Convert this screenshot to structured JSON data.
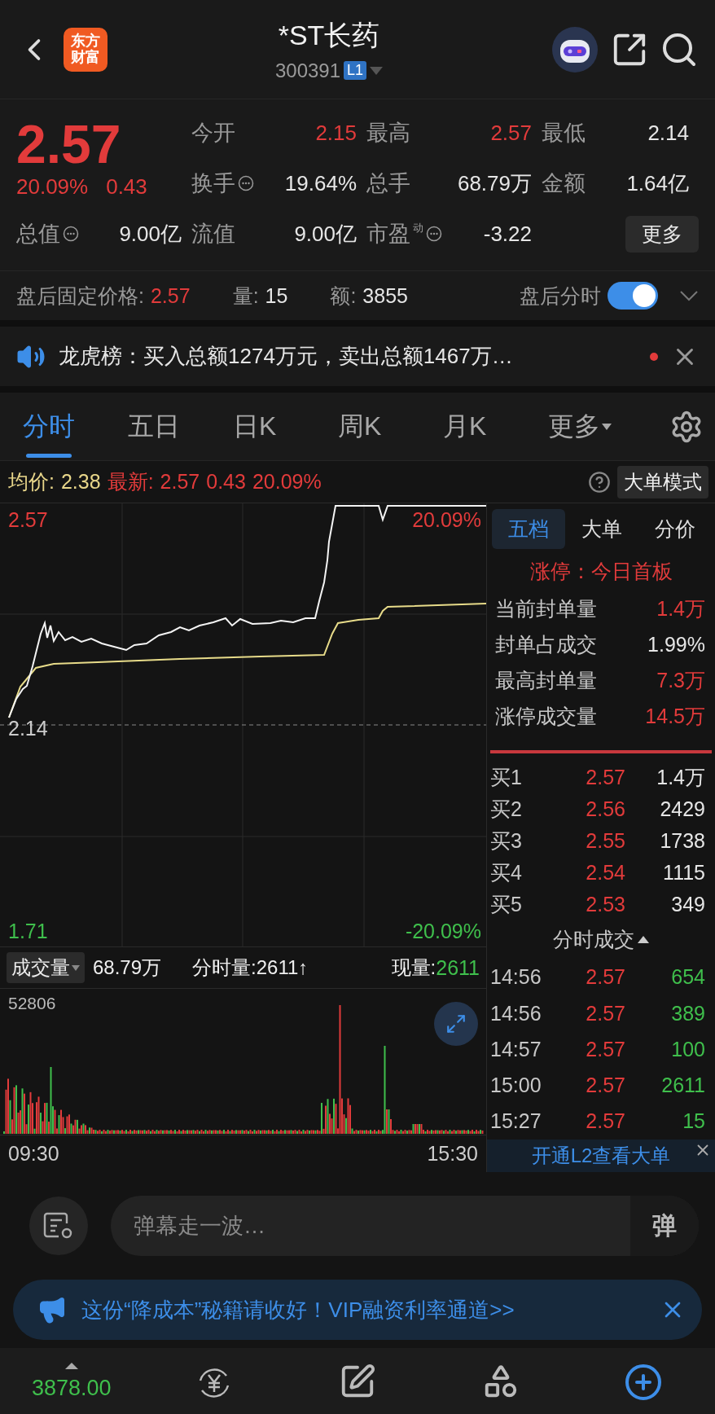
{
  "header": {
    "logo": "东方财富",
    "title": "*ST长药",
    "code": "300391",
    "level_badge": "L1"
  },
  "quote": {
    "price": "2.57",
    "change_pct": "20.09%",
    "change": "0.43",
    "more_button": "更多",
    "stats": [
      {
        "label": "今开",
        "value": "2.15",
        "color": "#e23b3b"
      },
      {
        "label": "最高",
        "value": "2.57",
        "color": "#e23b3b"
      },
      {
        "label": "最低",
        "value": "2.14",
        "color": "#e6e6e6"
      },
      {
        "label": "换手",
        "info": true,
        "value": "19.64%",
        "color": "#e6e6e6"
      },
      {
        "label": "总手",
        "value": "68.79万",
        "color": "#e6e6e6"
      },
      {
        "label": "金额",
        "value": "1.64亿",
        "color": "#e6e6e6"
      },
      {
        "label": "总值",
        "info": true,
        "value": "9.00亿",
        "color": "#e6e6e6"
      },
      {
        "label": "流值",
        "value": "9.00亿",
        "color": "#e6e6e6"
      },
      {
        "label": "市盈",
        "sup": "动",
        "info": true,
        "value": "-3.22",
        "color": "#e6e6e6"
      }
    ]
  },
  "after_hours": {
    "label": "盘后固定价格:",
    "price": "2.57",
    "vol_label": "量:",
    "vol": "15",
    "amt_label": "额:",
    "amt": "3855",
    "toggle_label": "盘后分时",
    "on": true
  },
  "notice": {
    "text": "龙虎榜：买入总额1274万元，卖出总额1467万…",
    "dot": true
  },
  "tabs": [
    {
      "label": "分时",
      "selected": true,
      "dropdown": false
    },
    {
      "label": "五日",
      "selected": false,
      "dropdown": false
    },
    {
      "label": "日K",
      "selected": false,
      "dropdown": false
    },
    {
      "label": "周K",
      "selected": false,
      "dropdown": false
    },
    {
      "label": "月K",
      "selected": false,
      "dropdown": false
    },
    {
      "label": "更多",
      "selected": false,
      "dropdown": true
    }
  ],
  "chart_header": {
    "avg_label": "均价:",
    "avg": "2.38",
    "last_label": "最新:",
    "last": "2.57",
    "change": "0.43",
    "pct": "20.09%",
    "mode_button": "大单模式"
  },
  "price_chart": {
    "high": "2.57",
    "high_pct": "20.09%",
    "base": "2.14",
    "low": "1.71",
    "low_pct": "-20.09%"
  },
  "volume": {
    "menu": "成交量",
    "total": "68.79万",
    "tick": "分时量:2611↑",
    "now_label": "现量:",
    "now": "2611",
    "max": "52806",
    "start": "09:30",
    "end": "15:30"
  },
  "panel": {
    "tabs": [
      {
        "label": "五档",
        "selected": true
      },
      {
        "label": "大单",
        "selected": false
      },
      {
        "label": "分价",
        "selected": false
      }
    ],
    "limit_title": "涨停：今日首板",
    "limit_stats": [
      {
        "label": "当前封单量",
        "value": "1.4万",
        "color": "#e23b3b"
      },
      {
        "label": "封单占成交",
        "value": "1.99%",
        "color": "#e6e6e6"
      },
      {
        "label": "最高封单量",
        "value": "7.3万",
        "color": "#e23b3b"
      },
      {
        "label": "涨停成交量",
        "value": "14.5万",
        "color": "#e23b3b"
      }
    ],
    "bids": [
      {
        "label": "买1",
        "price": "2.57",
        "volume": "1.4万"
      },
      {
        "label": "买2",
        "price": "2.56",
        "volume": "2429"
      },
      {
        "label": "买3",
        "price": "2.55",
        "volume": "1738"
      },
      {
        "label": "买4",
        "price": "2.54",
        "volume": "1115"
      },
      {
        "label": "买5",
        "price": "2.53",
        "volume": "349"
      }
    ],
    "trades_title": "分时成交",
    "trades": [
      {
        "time": "14:56",
        "price": "2.57",
        "volume": "654",
        "color": "#3fbf4c"
      },
      {
        "time": "14:56",
        "price": "2.57",
        "volume": "389",
        "color": "#3fbf4c"
      },
      {
        "time": "14:57",
        "price": "2.57",
        "volume": "100",
        "color": "#3fbf4c"
      },
      {
        "time": "15:00",
        "price": "2.57",
        "volume": "2611",
        "color": "#3fbf4c"
      },
      {
        "time": "15:27",
        "price": "2.57",
        "volume": "15",
        "color": "#3fbf4c"
      }
    ],
    "l2_banner": "开通L2查看大单"
  },
  "comment": {
    "placeholder": "弹幕走一波…",
    "send": "弹"
  },
  "ad": {
    "text": "这份“降成本”秘籍请收好！VIP融资利率通道>>"
  },
  "bottom_nav": [
    {
      "kind": "index",
      "value": "3878.00"
    },
    {
      "kind": "trade"
    },
    {
      "kind": "post"
    },
    {
      "kind": "tools"
    },
    {
      "kind": "add"
    }
  ]
}
